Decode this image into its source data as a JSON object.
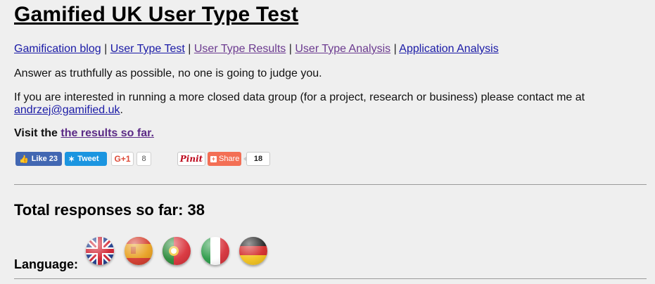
{
  "title": "Gamified UK User Type Test",
  "nav": [
    {
      "label": "Gamification blog",
      "visited": false
    },
    {
      "label": "User Type Test",
      "visited": false
    },
    {
      "label": "User Type Results",
      "visited": true
    },
    {
      "label": "User Type Analysis",
      "visited": true
    },
    {
      "label": "Application Analysis",
      "visited": false
    }
  ],
  "nav_separator": "|",
  "intro": "Answer as truthfully as possible, no one is going to judge you.",
  "contact_text": "If you are interested in running a more closed data group (for a project, research or business) please contact me at",
  "contact_email": "andrzej@gamified.uk",
  "contact_end": ".",
  "visit": {
    "prefix": "Visit the",
    "link": "the results so far."
  },
  "share": {
    "facebook_label": "Like 23",
    "twitter_label": "Tweet",
    "gplus_label": "G+1",
    "gplus_count": "8",
    "pinterest_label": "Pinit",
    "share_label": "Share",
    "share_count": "18"
  },
  "total_heading": "Total responses so far: 38",
  "language_label": "Language:",
  "languages": [
    "english-flag-icon",
    "spanish-flag-icon",
    "portuguese-flag-icon",
    "italian-flag-icon",
    "german-flag-icon"
  ]
}
